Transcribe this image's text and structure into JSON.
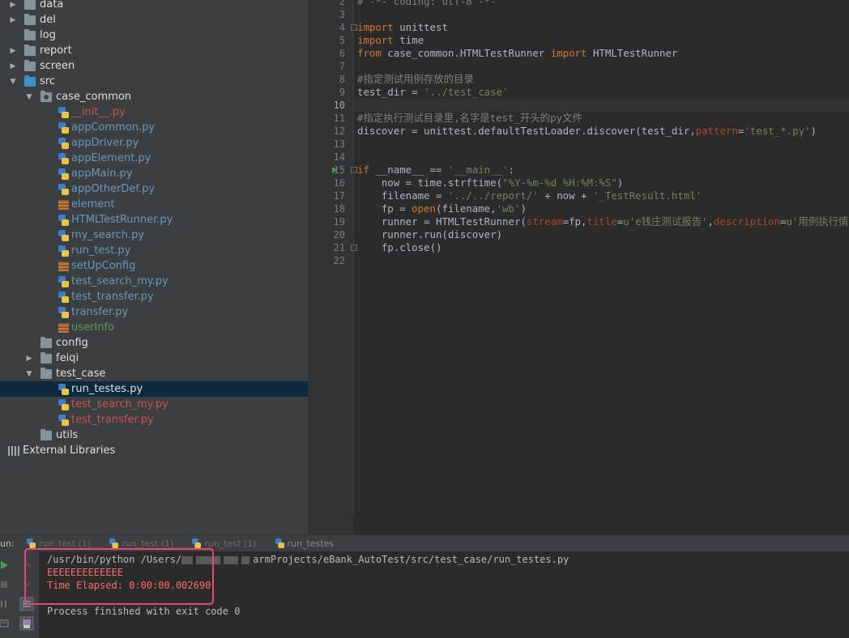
{
  "project_tree": {
    "rows": [
      {
        "label": "data",
        "kind": "folder",
        "indent": 0,
        "arrow": "▶",
        "color": "white"
      },
      {
        "label": "del",
        "kind": "folder",
        "indent": 0,
        "arrow": "▶",
        "color": "white"
      },
      {
        "label": "log",
        "kind": "folder",
        "indent": 0,
        "arrow": "",
        "color": "white"
      },
      {
        "label": "report",
        "kind": "folder",
        "indent": 0,
        "arrow": "▶",
        "color": "white"
      },
      {
        "label": "screen",
        "kind": "folder",
        "indent": 0,
        "arrow": "▶",
        "color": "white"
      },
      {
        "label": "src",
        "kind": "src",
        "indent": 0,
        "arrow": "▼",
        "color": "white"
      },
      {
        "label": "case_common",
        "kind": "pkg",
        "indent": 1,
        "arrow": "▼",
        "color": "white"
      },
      {
        "label": "__init__.py",
        "kind": "py",
        "indent": 2,
        "arrow": "",
        "color": "red"
      },
      {
        "label": "appCommon.py",
        "kind": "py",
        "indent": 2,
        "arrow": "",
        "color": "blue"
      },
      {
        "label": "appDriver.py",
        "kind": "py",
        "indent": 2,
        "arrow": "",
        "color": "blue"
      },
      {
        "label": "appElement.py",
        "kind": "py",
        "indent": 2,
        "arrow": "",
        "color": "blue"
      },
      {
        "label": "appMain.py",
        "kind": "py",
        "indent": 2,
        "arrow": "",
        "color": "blue"
      },
      {
        "label": "appOtherDef.py",
        "kind": "py",
        "indent": 2,
        "arrow": "",
        "color": "blue"
      },
      {
        "label": "element",
        "kind": "cfg",
        "indent": 2,
        "arrow": "",
        "color": "blue"
      },
      {
        "label": "HTMLTestRunner.py",
        "kind": "py",
        "indent": 2,
        "arrow": "",
        "color": "blue"
      },
      {
        "label": "my_search.py",
        "kind": "py",
        "indent": 2,
        "arrow": "",
        "color": "blue"
      },
      {
        "label": "run_test.py",
        "kind": "py",
        "indent": 2,
        "arrow": "",
        "color": "blue"
      },
      {
        "label": "setUpConfig",
        "kind": "cfg",
        "indent": 2,
        "arrow": "",
        "color": "blue"
      },
      {
        "label": "test_search_my.py",
        "kind": "py",
        "indent": 2,
        "arrow": "",
        "color": "blue"
      },
      {
        "label": "test_transfer.py",
        "kind": "py",
        "indent": 2,
        "arrow": "",
        "color": "blue"
      },
      {
        "label": "transfer.py",
        "kind": "py",
        "indent": 2,
        "arrow": "",
        "color": "blue"
      },
      {
        "label": "userInfo",
        "kind": "cfg",
        "indent": 2,
        "arrow": "",
        "color": "green"
      },
      {
        "label": "config",
        "kind": "folder",
        "indent": 1,
        "arrow": "",
        "color": "white"
      },
      {
        "label": "feiqi",
        "kind": "folder",
        "indent": 1,
        "arrow": "▶",
        "color": "white"
      },
      {
        "label": "test_case",
        "kind": "folder",
        "indent": 1,
        "arrow": "▼",
        "color": "white"
      },
      {
        "label": "run_testes.py",
        "kind": "py",
        "indent": 2,
        "arrow": "",
        "color": "white",
        "selected": true
      },
      {
        "label": "test_search_my.py",
        "kind": "py",
        "indent": 2,
        "arrow": "",
        "color": "red"
      },
      {
        "label": "test_transfer.py",
        "kind": "py",
        "indent": 2,
        "arrow": "",
        "color": "red"
      },
      {
        "label": "utils",
        "kind": "folder",
        "indent": 1,
        "arrow": "",
        "color": "white"
      },
      {
        "label": "External Libraries",
        "kind": "lib",
        "indent": -1,
        "arrow": "",
        "color": "white"
      }
    ]
  },
  "editor": {
    "current_line": "10",
    "lines": [
      {
        "no": "2",
        "tokens": [
          {
            "t": "# -*- coding: utf-8 -*-",
            "c": "cmt"
          }
        ]
      },
      {
        "no": "3",
        "tokens": []
      },
      {
        "no": "4",
        "tokens": [
          {
            "t": "import",
            "c": "kw"
          },
          {
            "t": " unittest",
            "c": ""
          }
        ]
      },
      {
        "no": "5",
        "tokens": [
          {
            "t": "import",
            "c": "kw"
          },
          {
            "t": " time",
            "c": ""
          }
        ]
      },
      {
        "no": "6",
        "tokens": [
          {
            "t": "from",
            "c": "kw"
          },
          {
            "t": " case_common.HTMLTestRunner ",
            "c": ""
          },
          {
            "t": "import",
            "c": "kw"
          },
          {
            "t": " HTMLTestRunner",
            "c": ""
          }
        ]
      },
      {
        "no": "7",
        "tokens": []
      },
      {
        "no": "8",
        "tokens": [
          {
            "t": "#指定测试用例存放的目录",
            "c": "cmt"
          }
        ]
      },
      {
        "no": "9",
        "tokens": [
          {
            "t": "test_dir = ",
            "c": ""
          },
          {
            "t": "'../test_case'",
            "c": "str"
          }
        ]
      },
      {
        "no": "10",
        "tokens": []
      },
      {
        "no": "11",
        "tokens": [
          {
            "t": "#指定执行测试目录里,名字是test_开头的py文件",
            "c": "cmt"
          }
        ]
      },
      {
        "no": "12",
        "tokens": [
          {
            "t": "discover = unittest.defaultTestLoader.discover(test_dir,",
            "c": ""
          },
          {
            "t": "pattern",
            "c": "prm"
          },
          {
            "t": "=",
            "c": ""
          },
          {
            "t": "'test_*.py'",
            "c": "str"
          },
          {
            "t": ")",
            "c": ""
          }
        ]
      },
      {
        "no": "13",
        "tokens": []
      },
      {
        "no": "14",
        "tokens": []
      },
      {
        "no": "15",
        "tokens": [
          {
            "t": "if",
            "c": "kw"
          },
          {
            "t": " __name__ == ",
            "c": ""
          },
          {
            "t": "'__main__'",
            "c": "str"
          },
          {
            "t": ":",
            "c": ""
          }
        ]
      },
      {
        "no": "16",
        "tokens": [
          {
            "t": "    now = time.strftime(",
            "c": ""
          },
          {
            "t": "\"%Y-%m-%d %H:%M:%S\"",
            "c": "str"
          },
          {
            "t": ")",
            "c": ""
          }
        ]
      },
      {
        "no": "17",
        "tokens": [
          {
            "t": "    filename = ",
            "c": ""
          },
          {
            "t": "'../../report/'",
            "c": "str"
          },
          {
            "t": " + now + ",
            "c": ""
          },
          {
            "t": "'_TestResult.html'",
            "c": "str"
          }
        ]
      },
      {
        "no": "18",
        "tokens": [
          {
            "t": "    fp = ",
            "c": ""
          },
          {
            "t": "open",
            "c": "kw"
          },
          {
            "t": "(filename,",
            "c": ""
          },
          {
            "t": "'wb'",
            "c": "str"
          },
          {
            "t": ")",
            "c": ""
          }
        ]
      },
      {
        "no": "19",
        "tokens": [
          {
            "t": "    runner = HTMLTestRunner(",
            "c": ""
          },
          {
            "t": "stream",
            "c": "prm"
          },
          {
            "t": "=fp,",
            "c": ""
          },
          {
            "t": "title",
            "c": "prm"
          },
          {
            "t": "=",
            "c": ""
          },
          {
            "t": "u'e钱庄测试报告'",
            "c": "str"
          },
          {
            "t": ",",
            "c": ""
          },
          {
            "t": "description",
            "c": "prm"
          },
          {
            "t": "=",
            "c": ""
          },
          {
            "t": "u'用例执行情况:')",
            "c": "str"
          }
        ]
      },
      {
        "no": "20",
        "tokens": [
          {
            "t": "    runner.run(discover)",
            "c": ""
          }
        ]
      },
      {
        "no": "21",
        "tokens": [
          {
            "t": "    fp.close()",
            "c": ""
          }
        ]
      },
      {
        "no": "22",
        "tokens": []
      }
    ]
  },
  "run_panel": {
    "label": "un:",
    "tabs": [
      {
        "label": "run_test (1)",
        "active": false
      },
      {
        "label": "run_test (1)",
        "active": false
      },
      {
        "label": "run_test (1)",
        "active": false
      },
      {
        "label": "run_testes",
        "active": true
      }
    ],
    "console": {
      "command_prefix": "/usr/bin/python /Users/",
      "command_suffix": "armProjects/eBank_AutoTest/src/test_case/run_testes.py",
      "error_lines": [
        "EEEEEEEEEEEEE",
        "Time Elapsed: 0:00:00.002690"
      ],
      "exit_message": "Process finished with exit code 0"
    }
  },
  "colors": {
    "accent_highlight": "#e8467a",
    "run_green": "#499c54",
    "selection": "#0d293e"
  }
}
